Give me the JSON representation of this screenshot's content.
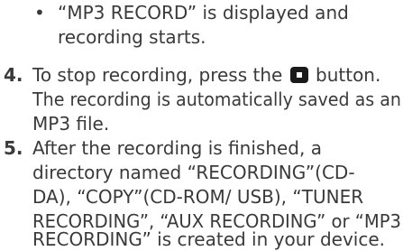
{
  "bullet_glyph": "•",
  "bullet_item": {
    "line1": "“MP3 RECORD” is displayed and",
    "line2": "recording starts."
  },
  "step4": {
    "number": "4.",
    "line1_before_icon": "To stop recording, press the",
    "icon": "stop-button-icon",
    "line1_after_icon": "button.",
    "line2": "The recording is automatically saved as an",
    "line3": "MP3 file."
  },
  "step5": {
    "number": "5.",
    "line1": "After the recording is finished, a",
    "line2": "directory named “RECORDING”(CD-",
    "line3": "DA), “COPY”(CD-ROM/ USB), “TUNER",
    "line4": "RECORDING”, “AUX RECORDING” or “MP3",
    "line5": "RECORDING” is created in your device."
  },
  "colors": {
    "text": "#3a3a3a",
    "icon": "#1a1a1a"
  }
}
